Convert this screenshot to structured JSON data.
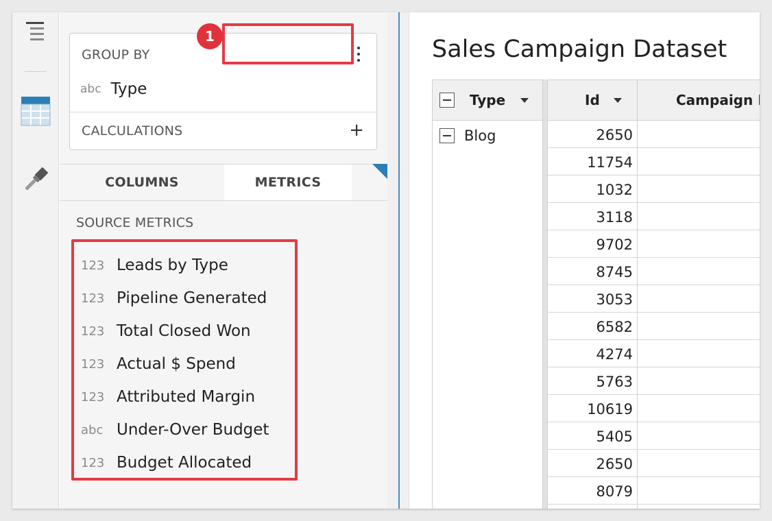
{
  "rail": {
    "icons": [
      "menu-icon",
      "table-icon",
      "paintbrush-icon"
    ]
  },
  "panel": {
    "group_by": {
      "label": "GROUP BY",
      "field_type": "abc",
      "field_name": "Type"
    },
    "calculations": {
      "label": "CALCULATIONS",
      "add_symbol": "+"
    },
    "tabs": {
      "columns": "COLUMNS",
      "metrics": "METRICS",
      "active": "METRICS"
    },
    "badge": "1",
    "source_metrics_label": "SOURCE METRICS",
    "metrics": [
      {
        "type": "123",
        "name": "Leads by Type"
      },
      {
        "type": "123",
        "name": "Pipeline Generated"
      },
      {
        "type": "123",
        "name": "Total Closed Won"
      },
      {
        "type": "123",
        "name": "Actual $ Spend"
      },
      {
        "type": "123",
        "name": "Attributed Margin"
      },
      {
        "type": "abc",
        "name": "Under-Over Budget"
      },
      {
        "type": "123",
        "name": "Budget Allocated"
      }
    ],
    "highlight_color": "#e43a45"
  },
  "main": {
    "title": "Sales Campaign Dataset",
    "columns": [
      "Type",
      "Id",
      "Campaign Id"
    ],
    "group_value": "Blog",
    "ids": [
      "2650",
      "11754",
      "1032",
      "3118",
      "9702",
      "8745",
      "3053",
      "6582",
      "4274",
      "5763",
      "10619",
      "5405",
      "2650",
      "8079"
    ]
  }
}
